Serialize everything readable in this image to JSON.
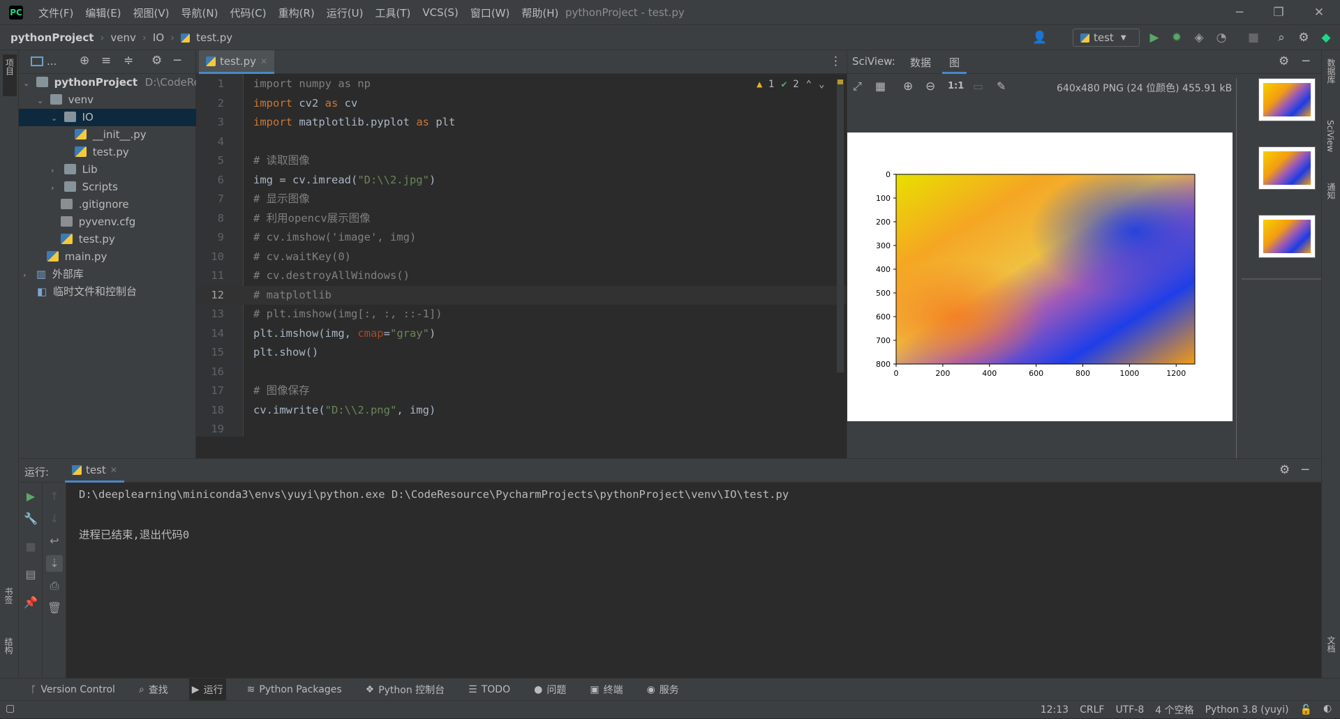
{
  "app": {
    "window_title": "pythonProject - test.py",
    "menu": [
      "文件(F)",
      "编辑(E)",
      "视图(V)",
      "导航(N)",
      "代码(C)",
      "重构(R)",
      "运行(U)",
      "工具(T)",
      "VCS(S)",
      "窗口(W)",
      "帮助(H)"
    ]
  },
  "breadcrumb": [
    "pythonProject",
    "venv",
    "IO",
    "test.py"
  ],
  "run_config": "test",
  "left_strip": {
    "top": "项目",
    "mid": "书签",
    "bottom": "结构"
  },
  "right_strip": {
    "a": "数据库",
    "b": "SciView",
    "c": "通知",
    "d": "文档"
  },
  "project": {
    "toolbar_label": "...",
    "tree": [
      {
        "label": "pythonProject",
        "hint": "D:\\CodeRes",
        "arrow": "⌄",
        "icon": "folder"
      },
      {
        "label": "venv",
        "arrow": "⌄",
        "icon": "folder"
      },
      {
        "label": "IO",
        "arrow": "⌄",
        "icon": "folder"
      },
      {
        "label": "__init__.py",
        "arrow": "",
        "icon": "python-file-icon"
      },
      {
        "label": "test.py",
        "arrow": "",
        "icon": "python-file-icon"
      },
      {
        "label": "Lib",
        "arrow": "›",
        "icon": "folder"
      },
      {
        "label": "Scripts",
        "arrow": "›",
        "icon": "folder"
      },
      {
        "label": ".gitignore",
        "arrow": "",
        "icon": "text-file-icon"
      },
      {
        "label": "pyvenv.cfg",
        "arrow": "",
        "icon": "text-file-icon"
      },
      {
        "label": "test.py",
        "arrow": "",
        "icon": "python-file-icon"
      },
      {
        "label": "main.py",
        "arrow": "",
        "icon": "python-file-icon"
      },
      {
        "label": "外部库",
        "arrow": "›",
        "icon": "library-icon"
      },
      {
        "label": "临时文件和控制台",
        "arrow": "",
        "icon": "scratch-icon"
      }
    ]
  },
  "editor": {
    "tab": "test.py",
    "warnings": "1",
    "weak_warnings": "2",
    "current_line": 12,
    "line_numbers": [
      "1",
      "2",
      "3",
      "4",
      "5",
      "6",
      "7",
      "8",
      "9",
      "10",
      "11",
      "12",
      "13",
      "14",
      "15",
      "16",
      "17",
      "18",
      "19"
    ],
    "lines": [
      [
        {
          "t": "import numpy as np",
          "c": "cm"
        }
      ],
      [
        {
          "t": "import",
          "c": "kw"
        },
        {
          "t": " cv2 ",
          "c": ""
        },
        {
          "t": "as",
          "c": "kw"
        },
        {
          "t": " cv",
          "c": ""
        }
      ],
      [
        {
          "t": "import",
          "c": "kw"
        },
        {
          "t": " matplotlib.pyplot ",
          "c": ""
        },
        {
          "t": "as",
          "c": "kw"
        },
        {
          "t": " plt",
          "c": ""
        }
      ],
      [],
      [
        {
          "t": "# 读取图像",
          "c": "cm"
        }
      ],
      [
        {
          "t": "img = cv.imread(",
          "c": ""
        },
        {
          "t": "\"D:\\\\2.jpg\"",
          "c": "st"
        },
        {
          "t": ")",
          "c": ""
        }
      ],
      [
        {
          "t": "# 显示图像",
          "c": "cm"
        }
      ],
      [
        {
          "t": "# 利用opencv展示图像",
          "c": "cm"
        }
      ],
      [
        {
          "t": "# cv.imshow('image', img)",
          "c": "cm"
        }
      ],
      [
        {
          "t": "# cv.waitKey(0)",
          "c": "cm"
        }
      ],
      [
        {
          "t": "# cv.destroyAllWindows()",
          "c": "cm"
        }
      ],
      [
        {
          "t": "# matplotlib",
          "c": "cm"
        }
      ],
      [
        {
          "t": "# plt.imshow(img[:, :, ::-1])",
          "c": "cm"
        }
      ],
      [
        {
          "t": "plt.imshow(img, ",
          "c": ""
        },
        {
          "t": "cmap",
          "c": "pa"
        },
        {
          "t": "=",
          "c": ""
        },
        {
          "t": "\"gray\"",
          "c": "st"
        },
        {
          "t": ")",
          "c": ""
        }
      ],
      [
        {
          "t": "plt.show()",
          "c": ""
        }
      ],
      [],
      [
        {
          "t": "# 图像保存",
          "c": "cm"
        }
      ],
      [
        {
          "t": "cv.imwrite(",
          "c": ""
        },
        {
          "t": "\"D:\\\\2.png\"",
          "c": "st"
        },
        {
          "t": ", img)",
          "c": ""
        }
      ],
      []
    ]
  },
  "sciview": {
    "title": "SciView:",
    "tabs": [
      "数据",
      "图"
    ],
    "image_info": "640x480 PNG (24 位颜色) 455.91 kB",
    "zoom_label": "1:1"
  },
  "chart_data": {
    "type": "heatmap",
    "title": "",
    "xlabel": "",
    "ylabel": "",
    "x_ticks": [
      "0",
      "200",
      "400",
      "600",
      "800",
      "1000",
      "1200"
    ],
    "y_ticks": [
      "0",
      "100",
      "200",
      "300",
      "400",
      "500",
      "600",
      "700",
      "800"
    ],
    "xlim": [
      0,
      1280
    ],
    "ylim": [
      800,
      0
    ]
  },
  "run": {
    "label": "运行:",
    "tab": "test",
    "command": "D:\\deeplearning\\miniconda3\\envs\\yuyi\\python.exe D:\\CodeResource\\PycharmProjects\\pythonProject\\venv\\IO\\test.py",
    "exit_message": "进程已结束,退出代码0"
  },
  "bottom_tools": [
    "Version Control",
    "查找",
    "运行",
    "Python Packages",
    "Python 控制台",
    "TODO",
    "问题",
    "终端",
    "服务"
  ],
  "status": {
    "position": "12:13",
    "line_sep": "CRLF",
    "encoding": "UTF-8",
    "indent": "4 个空格",
    "interpreter": "Python 3.8 (yuyi)"
  },
  "colors": {
    "accent": "#4a88c7",
    "keyword": "#cc7832",
    "string": "#6a8759",
    "comment": "#808080",
    "param": "#aa4926",
    "run_green": "#59a869"
  }
}
